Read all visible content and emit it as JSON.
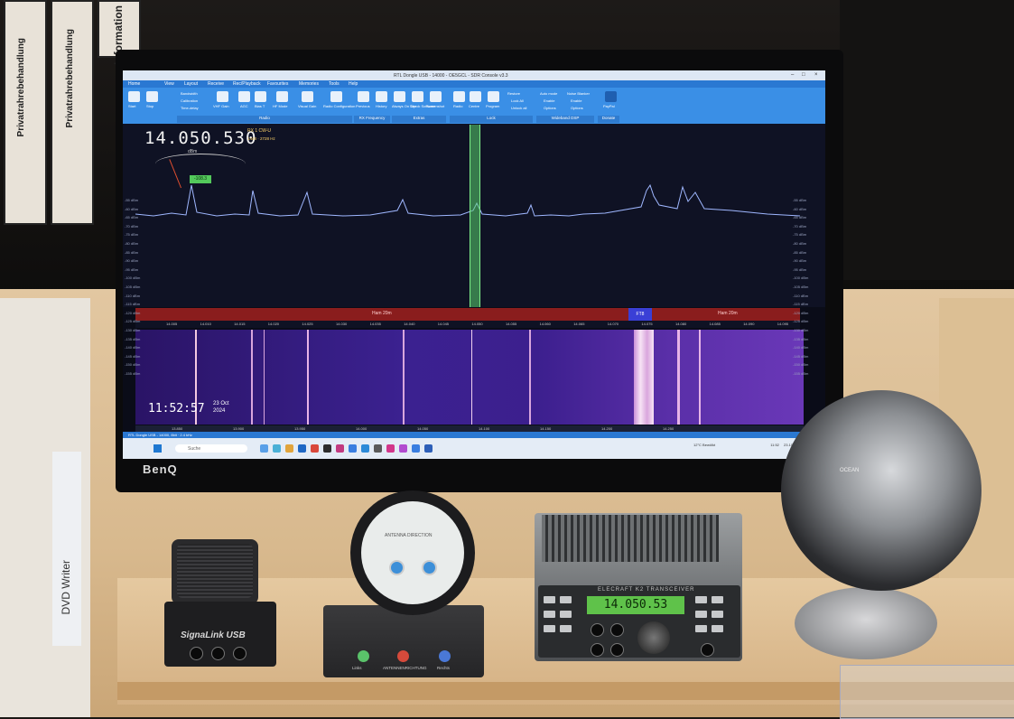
{
  "binders": [
    {
      "label": "Privatrahrebehandlung"
    },
    {
      "label": "Privatrahrebehandlung"
    },
    {
      "label": "Information"
    }
  ],
  "monitor": {
    "brand": "BenQ"
  },
  "sdr": {
    "title": "RTL Dongle USB - 14000 - OE5GCL - SDR Console v3.3",
    "menu": [
      "Home",
      "View",
      "Layout",
      "Receive",
      "Rec/Playback",
      "Favourites",
      "Memories",
      "Tools",
      "Help"
    ],
    "ribbon_groups": [
      "Radio",
      "RX Frequency",
      "Extras",
      "Lock",
      "Wideband DSP",
      "Donate"
    ],
    "ribbon_labels": [
      "Start",
      "Stop",
      "Bandwidth",
      "Calibration",
      "Time-delay",
      "VHF Gain",
      "AGC",
      "Bias T",
      "HF Mode",
      "Visual Gain",
      "Radio Configuration",
      "Previous",
      "History",
      "Always On Top",
      "Check Software",
      "Screenshot",
      "Radio",
      "Centre",
      "Program",
      "Restore",
      "Lock All",
      "Unlock all",
      "Auto mode",
      "Enable",
      "Options",
      "Noise Blanker",
      "PayPal"
    ],
    "frequency": "14.050.530",
    "rx_label": "RX 1",
    "mode": "CW-U",
    "rx_sub": "1448 · 2728 Hz",
    "dbm_label": "dBm",
    "signal_level": "-108.3",
    "y_axis": [
      "-55 dBm",
      "-60 dBm",
      "-65 dBm",
      "-70 dBm",
      "-75 dBm",
      "-80 dBm",
      "-85 dBm",
      "-90 dBm",
      "-95 dBm",
      "-100 dBm",
      "-105 dBm",
      "-110 dBm",
      "-115 dBm",
      "-120 dBm",
      "-125 dBm",
      "-130 dBm",
      "-135 dBm",
      "-140 dBm",
      "-145 dBm",
      "-150 dBm",
      "-155 dBm"
    ],
    "band_label_left": "Ham 20m",
    "band_label_right": "Ham 20m",
    "ft8_label": "FT8",
    "freq_ticks": [
      "14.005",
      "14.010",
      "14.015",
      "14.020",
      "14.025",
      "14.030",
      "14.035",
      "14.040",
      "14.045",
      "14.050",
      "14.055",
      "14.060",
      "14.065",
      "14.070",
      "14.075",
      "14.080",
      "14.085",
      "14.090",
      "14.095"
    ],
    "clock_hms": "11:52:57",
    "date_day_month": "23 Oct",
    "date_year": "2024",
    "lower_scale": [
      "13.850",
      "13.900",
      "13.950",
      "14.000",
      "14.050",
      "14.100",
      "14.150",
      "14.200",
      "14.250"
    ],
    "status_text": "RTL Dongle USB - 14000, 8bit · 2.4 kHz",
    "taskbar": {
      "search": "Suche",
      "weather": "12°C Bewölkt",
      "time": "11:52",
      "date": "23.10.2024"
    }
  },
  "signalink": {
    "label": "SignaLink USB"
  },
  "rotor": {
    "title": "ANTENNA DIRECTION",
    "base_left": "Links",
    "base_center": "ANTENNENRICHTUNG",
    "base_right": "Rechts"
  },
  "transceiver": {
    "brand": "ELECRAFT K2 TRANSCEIVER",
    "display": "14.050.53"
  },
  "globe": {
    "label": "OCEAN"
  },
  "dvd": {
    "label": "DVD Writer"
  },
  "colors": {
    "spectrum_trace": "#9fb7ff",
    "band_bar": "#8a1d1d",
    "filter": "#5ad26e",
    "k2_display": "#5fc24a",
    "ribbon": "#3a8fe6"
  }
}
